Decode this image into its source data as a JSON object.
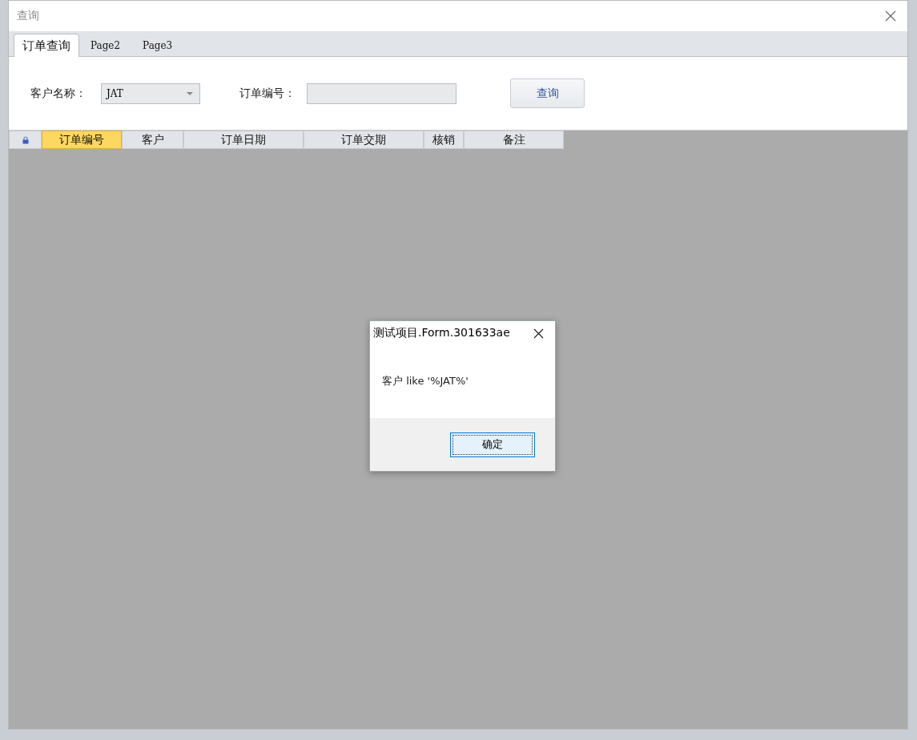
{
  "window": {
    "title": "查询"
  },
  "tabs": [
    {
      "label": "订单查询",
      "selected": true
    },
    {
      "label": "Page2",
      "selected": false
    },
    {
      "label": "Page3",
      "selected": false
    }
  ],
  "form": {
    "customer_label": "客户名称：",
    "customer_value": "JAT",
    "order_label": "订单编号：",
    "query_button": "查询"
  },
  "grid": {
    "columns": [
      {
        "label": "订单编号",
        "selected": true
      },
      {
        "label": "客户",
        "selected": false
      },
      {
        "label": "订单日期",
        "selected": false
      },
      {
        "label": "订单交期",
        "selected": false
      },
      {
        "label": "核销",
        "selected": false
      },
      {
        "label": "备注",
        "selected": false
      }
    ]
  },
  "dialog": {
    "title": "测试项目.Form.301633ae",
    "message": "客户 like '%JAT%'",
    "button": "确定"
  }
}
